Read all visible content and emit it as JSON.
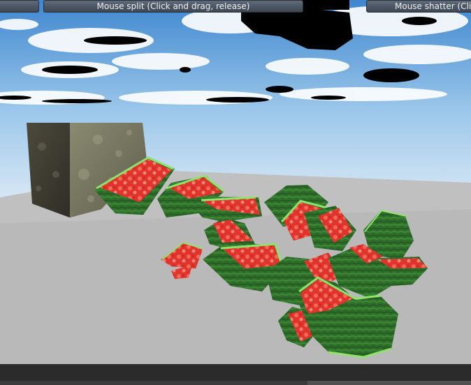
{
  "hud": {
    "left_label": "",
    "split_label": "Mouse split (Click and drag, release)",
    "shatter_label": "Mouse shatter (Clic"
  },
  "colors": {
    "sky_top": "#3f87cf",
    "sky_bottom": "#cfe3f3",
    "floor": "#b9b9b9",
    "cube": "#6b6a55",
    "rind_dark": "#2f6e2a",
    "rind_light": "#8ee46a",
    "flesh": "#e23b32"
  }
}
